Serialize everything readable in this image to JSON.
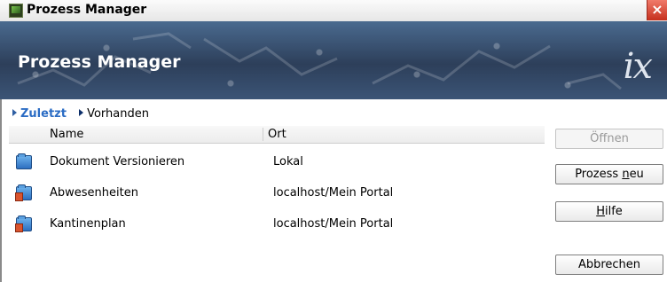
{
  "window": {
    "title": "Prozess Manager",
    "close_glyph": "×"
  },
  "banner": {
    "title": "Prozess Manager",
    "logo": "ix"
  },
  "nav": [
    {
      "label": "Zuletzt",
      "active": true
    },
    {
      "label": "Vorhanden",
      "active": false
    }
  ],
  "list": {
    "columns": {
      "name": "Name",
      "ort": "Ort"
    },
    "rows": [
      {
        "name": "Dokument Versionieren",
        "ort": "Lokal",
        "icon": "folder-icon"
      },
      {
        "name": "Abwesenheiten",
        "ort": "localhost/Mein Portal",
        "icon": "portal-folder-icon"
      },
      {
        "name": "Kantinenplan",
        "ort": "localhost/Mein Portal",
        "icon": "portal-folder-icon"
      }
    ]
  },
  "buttons": {
    "open": {
      "label": "Öffnen",
      "enabled": false
    },
    "new_prefix": "Prozess ",
    "new_mnemonic": "n",
    "new_suffix": "eu",
    "help_mnemonic": "H",
    "help_suffix": "ilfe",
    "cancel": "Abbrechen"
  },
  "colors": {
    "nav_active": "#2b6cc4",
    "banner": "#2d3f5a",
    "close": "#c52f1d"
  }
}
